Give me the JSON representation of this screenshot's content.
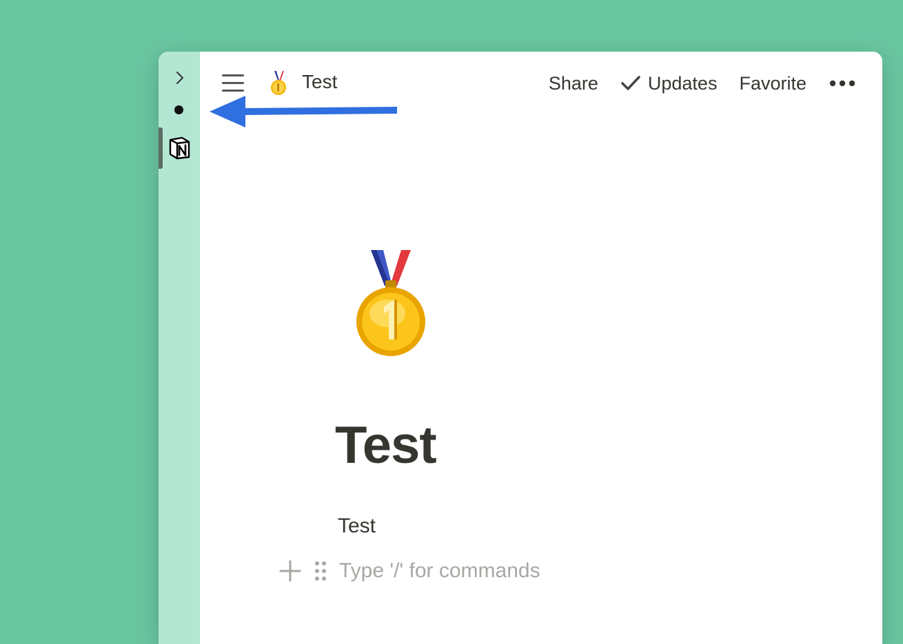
{
  "breadcrumb": {
    "icon": "medal-icon",
    "title": "Test"
  },
  "toolbar": {
    "share_label": "Share",
    "updates_label": "Updates",
    "favorite_label": "Favorite",
    "more_icon": "more-horizontal-icon"
  },
  "page": {
    "icon": "medal-icon",
    "title": "Test",
    "blocks": [
      {
        "text": "Test"
      }
    ],
    "new_block_placeholder": "Type '/' for commands"
  },
  "colors": {
    "background": "#69c5a0",
    "sidebar_strip": "#b3e6d3",
    "annotation_arrow": "#2f6fdf",
    "text": "#37352f",
    "placeholder_text": "#a8a7a3"
  }
}
